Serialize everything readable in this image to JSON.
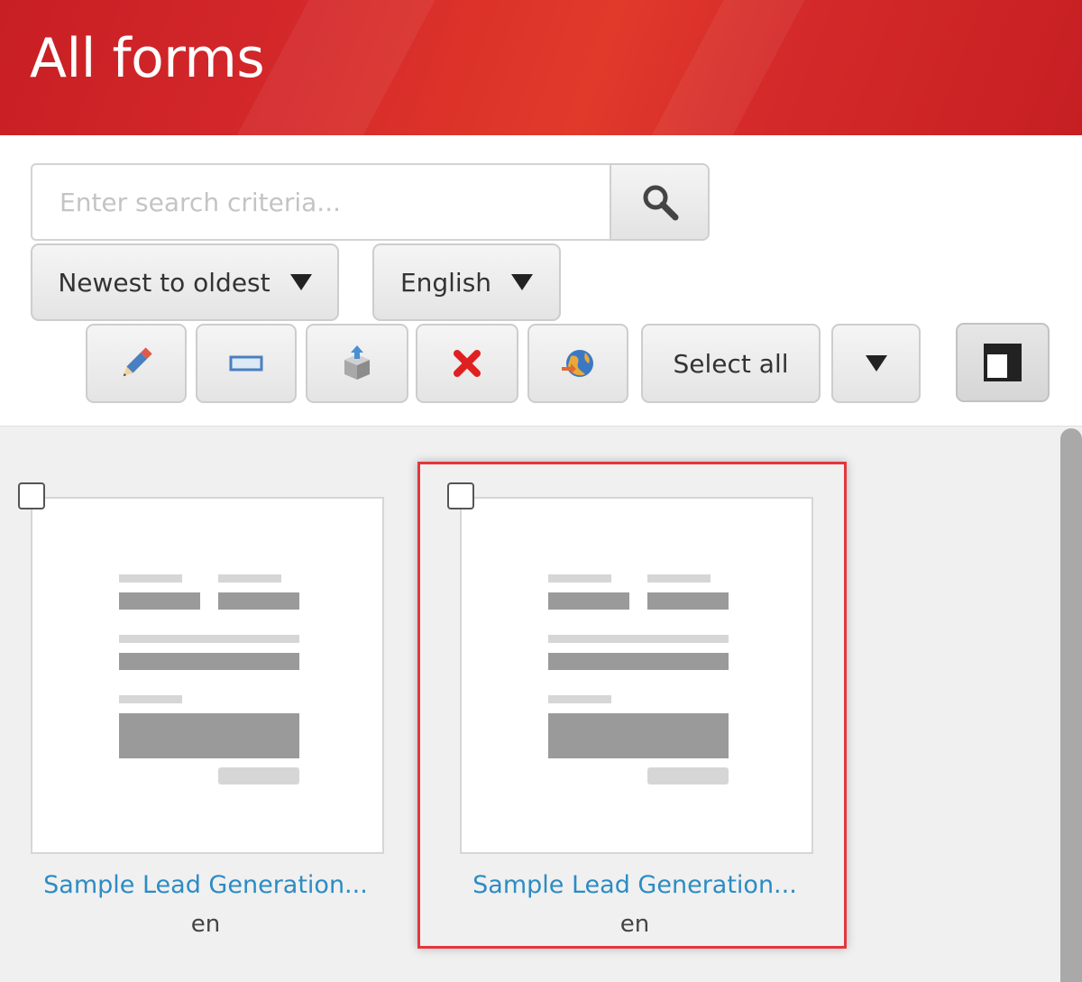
{
  "header": {
    "title": "All forms"
  },
  "search": {
    "placeholder": "Enter search criteria...",
    "icon": "magnifier-icon"
  },
  "sort": {
    "label": "Newest to oldest"
  },
  "language": {
    "label": "English"
  },
  "toolbar": {
    "select_all_label": "Select all",
    "buttons": [
      {
        "name": "edit-button",
        "icon": "pencil-icon"
      },
      {
        "name": "rename-button",
        "icon": "field-rectangle-icon"
      },
      {
        "name": "export-button",
        "icon": "box-export-icon"
      },
      {
        "name": "delete-button",
        "icon": "red-x-icon"
      },
      {
        "name": "translate-button",
        "icon": "globe-icon"
      }
    ],
    "view_toggle_icon": "layout-panel-icon"
  },
  "colors": {
    "header_red": "#d4282b",
    "link_blue": "#2b8cc4",
    "selection_red": "#e4363c",
    "delete_red": "#e02020"
  },
  "cards": [
    {
      "name": "Sample Lead Generation...",
      "lang": "en",
      "selected": false
    },
    {
      "name": "Sample Lead Generation...",
      "lang": "en",
      "selected": true
    }
  ]
}
